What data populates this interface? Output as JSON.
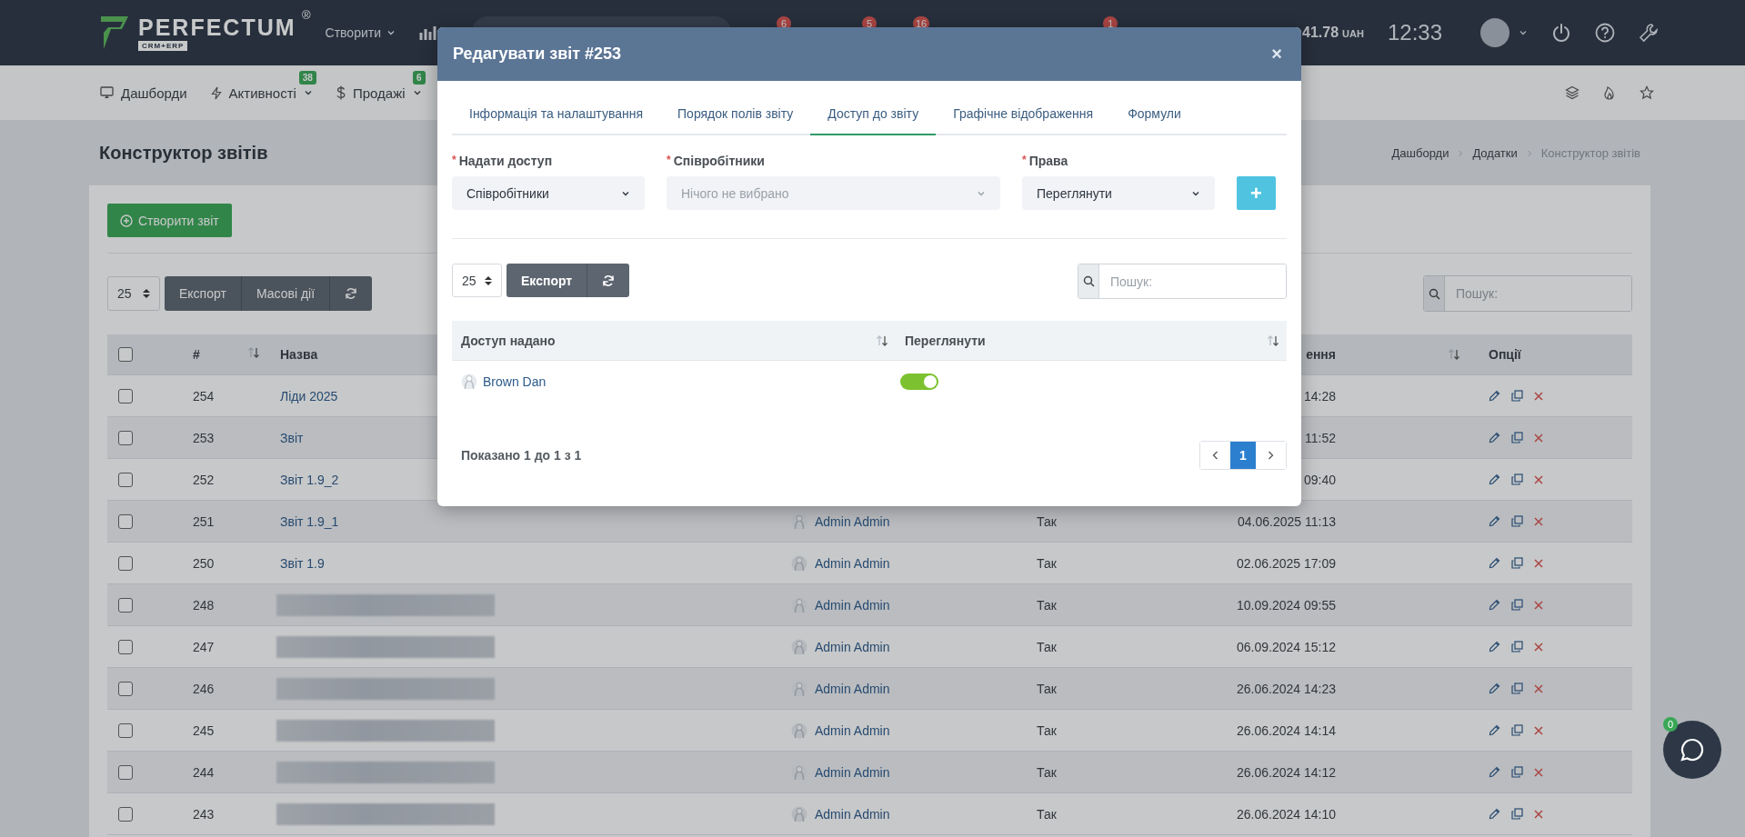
{
  "topbar": {
    "brand": "PERFECTUM",
    "brand_mark": "®",
    "brand_sub": "CRM+ERP",
    "create_menu": "Створити",
    "badges": [
      "6",
      "5",
      "16",
      "1"
    ],
    "balance": "41.78",
    "currency": "UAH",
    "time": "12:33"
  },
  "nav": {
    "items": [
      {
        "label": "Дашборди",
        "kind": "dashboards"
      },
      {
        "label": "Активності",
        "kind": "activities",
        "badge": "38"
      },
      {
        "label": "Продажі",
        "kind": "sales",
        "badge": "6"
      }
    ]
  },
  "page": {
    "title": "Конструктор звітів",
    "breadcrumbs": [
      "Дашборди",
      "Додатки",
      "Конструктор звітів"
    ]
  },
  "toolbar": {
    "create_button": "Створити звіт",
    "page_size": "25",
    "buttons": [
      "Експорт",
      "Масові дії"
    ],
    "search_placeholder": "Пошук:"
  },
  "table": {
    "all_checked": false,
    "columns": {
      "id": "#",
      "name": "Назва",
      "date": "ення",
      "options": "Опції"
    },
    "rows": [
      {
        "checked": false,
        "id": "254",
        "name": "Ліди 2025",
        "date": "14:28"
      },
      {
        "checked": false,
        "id": "253",
        "name": "Звіт",
        "date": "11:52"
      },
      {
        "checked": false,
        "id": "252",
        "name": "Звіт 1.9_2",
        "date": "09:40"
      },
      {
        "checked": false,
        "id": "251",
        "name": "Звіт 1.9_1",
        "author": "Admin Admin",
        "status": "Так",
        "date": "04.06.2025 11:13"
      },
      {
        "checked": false,
        "id": "250",
        "name": "Звіт 1.9",
        "author": "Admin Admin",
        "status": "Так",
        "date": "02.06.2025 17:09"
      },
      {
        "checked": false,
        "id": "248",
        "name_blurred": true,
        "author": "Admin Admin",
        "status": "Так",
        "date": "10.09.2024 09:55"
      },
      {
        "checked": false,
        "id": "247",
        "name_blurred": true,
        "author": "Admin Admin",
        "status": "Так",
        "date": "06.09.2024 15:12"
      },
      {
        "checked": false,
        "id": "246",
        "name_blurred": true,
        "author": "Admin Admin",
        "status": "Так",
        "date": "26.06.2024 14:23"
      },
      {
        "checked": false,
        "id": "245",
        "name_blurred": true,
        "author": "Admin Admin",
        "status": "Так",
        "date": "26.06.2024 14:14"
      },
      {
        "checked": false,
        "id": "244",
        "name_blurred": true,
        "author": "Admin Admin",
        "status": "Так",
        "date": "26.06.2024 14:12"
      },
      {
        "checked": false,
        "id": "243",
        "name_blurred": true,
        "author": "Admin Admin",
        "status": "Так",
        "date": "26.06.2024 14:10"
      }
    ]
  },
  "modal": {
    "title": "Редагувати звіт #253",
    "close": "×",
    "tabs": [
      {
        "label": "Інформація та налаштування",
        "selected": false
      },
      {
        "label": "Порядок полів звіту",
        "selected": false
      },
      {
        "label": "Доступ до звіту",
        "selected": true
      },
      {
        "label": "Графічне відображення",
        "selected": false
      },
      {
        "label": "Формули",
        "selected": false
      }
    ],
    "fields": [
      {
        "label": "Надати доступ",
        "mark": "*",
        "value": "Співробітники"
      },
      {
        "label": "Співробітники",
        "mark": "*",
        "placeholder": "Нічого не вибрано"
      },
      {
        "label": "Права",
        "mark": "*",
        "value": "Переглянути"
      }
    ],
    "add_button": "+",
    "page_size": "25",
    "export_button": "Експорт",
    "search_placeholder": "Пошук:",
    "table": {
      "columns": [
        "Доступ надано",
        "Переглянути"
      ],
      "rows": [
        {
          "user": "Brown Dan",
          "on": true
        }
      ]
    },
    "footer": "Показано 1 до 1 з 1",
    "pages": [
      {
        "label": "1",
        "selected": true
      }
    ]
  },
  "chat": {
    "badge": "0"
  }
}
